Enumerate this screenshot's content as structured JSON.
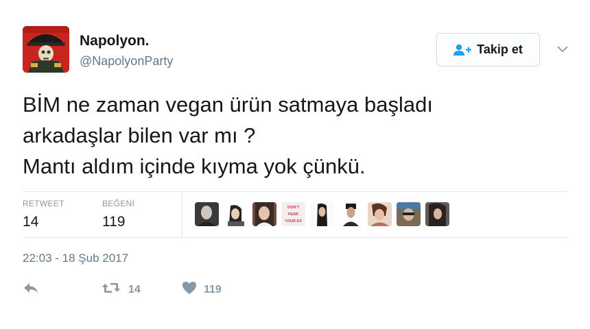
{
  "author": {
    "display_name": "Napolyon.",
    "handle": "@NapolyonParty"
  },
  "follow_button": {
    "label": "Takip et"
  },
  "tweet": {
    "lines": [
      "BİM ne zaman vegan ürün satmaya başladı",
      "arkadaşlar bilen var mı ?",
      "Mantı aldım içinde kıyma yok çünkü."
    ]
  },
  "stats": {
    "retweet_label": "RETWEET",
    "retweet_count": "14",
    "like_label": "BEĞENİ",
    "like_count": "119"
  },
  "likers": {
    "count": 9,
    "avatar_4_text": "DON'T FEAR YOUR EX"
  },
  "timestamp": "22:03 - 18 Şub 2017",
  "actions": {
    "retweet_count": "14",
    "like_count": "119"
  },
  "colors": {
    "accent": "#1da1f2",
    "secondary_text": "#657786",
    "muted_icon": "#8899a6",
    "divider": "#e1e8ed"
  },
  "icons": {
    "follow": "add-user-icon",
    "caret": "chevron-down-icon",
    "reply": "reply-icon",
    "retweet": "retweet-icon",
    "like": "heart-icon"
  }
}
